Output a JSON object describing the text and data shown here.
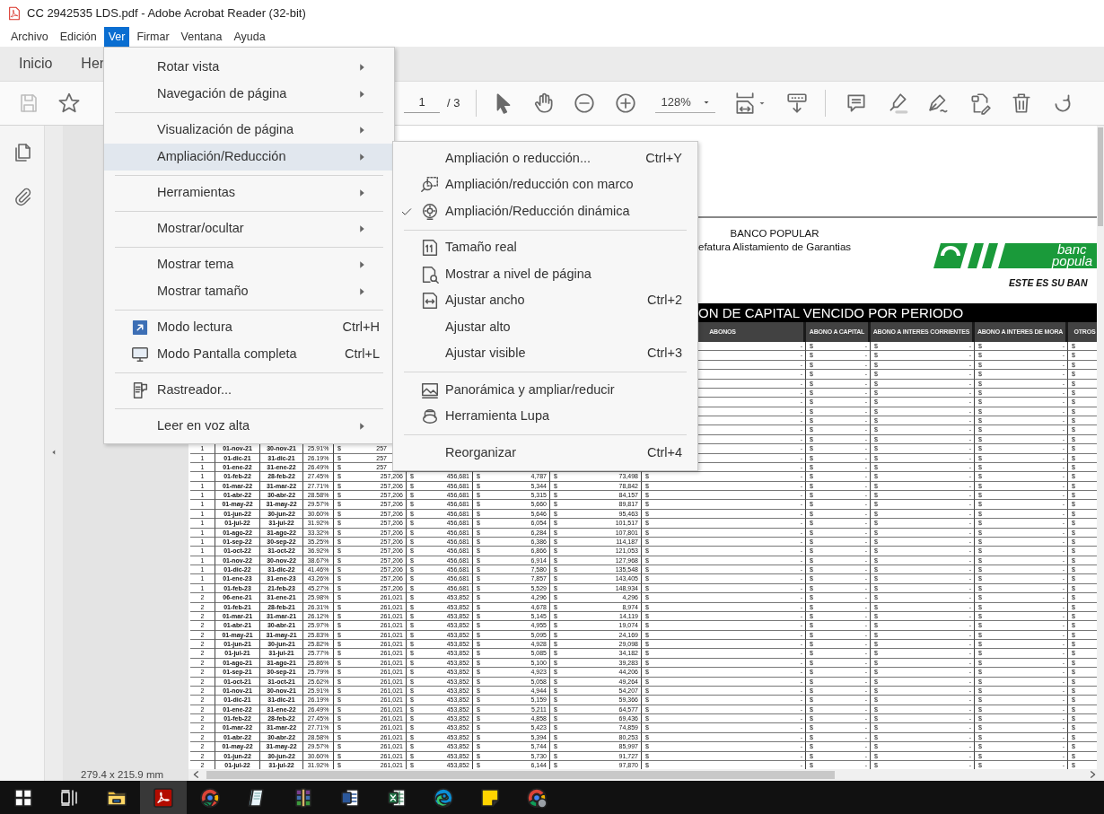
{
  "window": {
    "title": "CC 2942535 LDS.pdf - Adobe Acrobat Reader (32-bit)"
  },
  "menubar": [
    {
      "label": "Archivo",
      "selected": false
    },
    {
      "label": "Edición",
      "selected": false
    },
    {
      "label": "Ver",
      "selected": true
    },
    {
      "label": "Firmar",
      "selected": false
    },
    {
      "label": "Ventana",
      "selected": false
    },
    {
      "label": "Ayuda",
      "selected": false
    }
  ],
  "tabs": [
    {
      "label": "Inicio"
    },
    {
      "label": "Her"
    }
  ],
  "toolbar": {
    "save_disabled": true,
    "page": "1",
    "page_total": "/ 3",
    "zoom": "128%"
  },
  "view_menu": {
    "groups": [
      {
        "items": [
          {
            "label": "Rotar vista",
            "has_submenu": true,
            "selected": false
          },
          {
            "label": "Navegación de página",
            "has_submenu": true,
            "selected": false
          }
        ]
      },
      {
        "items": [
          {
            "label": "Visualización de página",
            "has_submenu": true,
            "selected": false
          },
          {
            "label": "Ampliación/Reducción",
            "has_submenu": true,
            "selected": true
          }
        ]
      },
      {
        "items": [
          {
            "label": "Herramientas",
            "has_submenu": true,
            "selected": false
          }
        ]
      },
      {
        "items": [
          {
            "label": "Mostrar/ocultar",
            "has_submenu": true,
            "selected": false
          }
        ]
      },
      {
        "items": [
          {
            "label": "Mostrar tema",
            "has_submenu": true,
            "selected": false
          },
          {
            "label": "Mostrar tamaño",
            "has_submenu": true,
            "selected": false
          }
        ]
      },
      {
        "items": [
          {
            "label": "Modo lectura",
            "shortcut": "Ctrl+H",
            "has_submenu": false,
            "selected": false
          },
          {
            "label": "Modo Pantalla completa",
            "shortcut": "Ctrl+L",
            "has_submenu": false,
            "selected": false
          }
        ]
      },
      {
        "items": [
          {
            "label": "Rastreador...",
            "has_submenu": false,
            "selected": false
          }
        ]
      },
      {
        "items": [
          {
            "label": "Leer en voz alta",
            "has_submenu": true,
            "selected": false
          }
        ]
      }
    ]
  },
  "zoom_submenu": {
    "groups": [
      {
        "items": [
          {
            "label": "Ampliación o reducción...",
            "shortcut": "Ctrl+Y",
            "checked": false
          },
          {
            "label": "Ampliación/reducción con marco",
            "checked": false
          },
          {
            "label": "Ampliación/Reducción dinámica",
            "checked": true
          }
        ]
      },
      {
        "items": [
          {
            "label": "Tamaño real",
            "checked": false
          },
          {
            "label": "Mostrar a nivel de página",
            "checked": false
          },
          {
            "label": "Ajustar ancho",
            "shortcut": "Ctrl+2",
            "checked": false
          },
          {
            "label": "Ajustar alto",
            "checked": false
          },
          {
            "label": "Ajustar visible",
            "shortcut": "Ctrl+3",
            "checked": false
          }
        ]
      },
      {
        "items": [
          {
            "label": "Panorámica y ampliar/reducir",
            "checked": false
          },
          {
            "label": "Herramienta Lupa",
            "checked": false
          }
        ]
      },
      {
        "items": [
          {
            "label": "Reorganizar",
            "shortcut": "Ctrl+4",
            "checked": false
          }
        ]
      }
    ]
  },
  "document": {
    "bank_name": "BANCO POPULAR",
    "department": "efatura Alistamiento de Garantias",
    "logo": {
      "line_1": "banc",
      "line_2": "popula",
      "slogan": "ESTE ES SU BAN"
    },
    "report_title": "ON DE CAPITAL VENCIDO POR PERIODO",
    "columns": [
      null,
      null,
      null,
      null,
      null,
      null,
      null,
      null,
      "ABONOS",
      "ABONO A CAPITAL",
      "ABONO A INTERES CORRIENTES",
      "ABONO A INTERES DE MORA",
      "OTROS"
    ],
    "rows": [
      {
        "kind": "right_only",
        "cells": [
          null,
          null,
          null,
          null,
          null,
          null,
          null,
          null,
          [
            null,
            "-"
          ],
          [
            "$",
            "-"
          ],
          [
            "$",
            "-"
          ],
          [
            "$",
            "-"
          ],
          [
            "$"
          ]
        ]
      },
      {
        "kind": "right_only",
        "cells": [
          null,
          null,
          null,
          null,
          null,
          null,
          null,
          null,
          [
            null,
            "-"
          ],
          [
            "$",
            "-"
          ],
          [
            "$",
            "-"
          ],
          [
            "$",
            "-"
          ],
          [
            "$"
          ]
        ]
      },
      {
        "kind": "right_only",
        "cells": [
          null,
          null,
          null,
          null,
          null,
          null,
          null,
          null,
          [
            null,
            "-"
          ],
          [
            "$",
            "-"
          ],
          [
            "$",
            "-"
          ],
          [
            "$",
            "-"
          ],
          [
            "$"
          ]
        ]
      },
      {
        "kind": "right_only",
        "cells": [
          null,
          null,
          null,
          null,
          null,
          null,
          null,
          null,
          [
            null,
            "-"
          ],
          [
            "$",
            "-"
          ],
          [
            "$",
            "-"
          ],
          [
            "$",
            "-"
          ],
          [
            "$"
          ]
        ]
      },
      {
        "kind": "right_only",
        "cells": [
          null,
          null,
          null,
          null,
          null,
          null,
          null,
          null,
          [
            null,
            "-"
          ],
          [
            "$",
            "-"
          ],
          [
            "$",
            "-"
          ],
          [
            "$",
            "-"
          ],
          [
            "$"
          ]
        ]
      },
      {
        "kind": "right_only",
        "cells": [
          null,
          null,
          null,
          null,
          null,
          null,
          null,
          null,
          [
            null,
            "-"
          ],
          [
            "$",
            "-"
          ],
          [
            "$",
            "-"
          ],
          [
            "$",
            "-"
          ],
          [
            "$"
          ]
        ]
      },
      {
        "kind": "right_only",
        "cells": [
          null,
          null,
          null,
          null,
          null,
          null,
          null,
          null,
          [
            null,
            "-"
          ],
          [
            "$",
            "-"
          ],
          [
            "$",
            "-"
          ],
          [
            "$",
            "-"
          ],
          [
            "$"
          ]
        ]
      },
      {
        "kind": "right_only",
        "cells": [
          null,
          null,
          null,
          null,
          null,
          null,
          null,
          null,
          [
            null,
            "-"
          ],
          [
            "$",
            "-"
          ],
          [
            "$",
            "-"
          ],
          [
            "$",
            "-"
          ],
          [
            "$"
          ]
        ]
      },
      {
        "kind": "right_only",
        "cells": [
          null,
          null,
          null,
          null,
          null,
          null,
          null,
          null,
          [
            null,
            "-"
          ],
          [
            "$",
            "-"
          ],
          [
            "$",
            "-"
          ],
          [
            "$",
            "-"
          ],
          [
            "$"
          ]
        ]
      },
      {
        "kind": "right_only",
        "cells": [
          null,
          null,
          null,
          null,
          null,
          null,
          null,
          null,
          [
            null,
            "-"
          ],
          [
            "$",
            "-"
          ],
          [
            "$",
            "-"
          ],
          [
            "$",
            "-"
          ],
          [
            "$"
          ]
        ]
      },
      {
        "kind": "right_only",
        "cells": [
          null,
          null,
          null,
          null,
          null,
          null,
          null,
          null,
          [
            null,
            "-"
          ],
          [
            "$",
            "-"
          ],
          [
            "$",
            "-"
          ],
          [
            "$",
            "-"
          ],
          [
            "$"
          ]
        ]
      },
      {
        "kind": "partial",
        "cells": [
          "1",
          "01-nov-21",
          "30-nov-21",
          "25.91%",
          [
            "$",
            "257"
          ],
          null,
          null,
          null,
          [
            null,
            "-"
          ],
          [
            "$",
            "-"
          ],
          [
            "$",
            "-"
          ],
          [
            "$",
            "-"
          ],
          [
            "$"
          ]
        ]
      },
      {
        "kind": "partial",
        "cells": [
          "1",
          "01-dic-21",
          "31-dic-21",
          "26.19%",
          [
            "$",
            "257"
          ],
          null,
          null,
          null,
          [
            null,
            "-"
          ],
          [
            "$",
            "-"
          ],
          [
            "$",
            "-"
          ],
          [
            "$",
            "-"
          ],
          [
            "$"
          ]
        ]
      },
      {
        "kind": "partial",
        "cells": [
          "1",
          "01-ene-22",
          "31-ene-22",
          "26.49%",
          [
            "$",
            "257"
          ],
          null,
          null,
          null,
          [
            null,
            "-"
          ],
          [
            "$",
            "-"
          ],
          [
            "$",
            "-"
          ],
          [
            "$",
            "-"
          ],
          [
            "$"
          ]
        ]
      },
      {
        "kind": "full",
        "cells": [
          "1",
          "01-feb-22",
          "28-feb-22",
          "27.45%",
          [
            "$",
            "257,206"
          ],
          [
            "$",
            "456,681"
          ],
          [
            "$",
            "4,787"
          ],
          [
            "$",
            "73,498"
          ],
          [
            "$",
            "-"
          ],
          [
            "$",
            "-"
          ],
          [
            "$",
            "-"
          ],
          [
            "$",
            "-"
          ],
          [
            "$"
          ]
        ]
      },
      {
        "kind": "full",
        "cells": [
          "1",
          "01-mar-22",
          "31-mar-22",
          "27.71%",
          [
            "$",
            "257,206"
          ],
          [
            "$",
            "456,681"
          ],
          [
            "$",
            "5,344"
          ],
          [
            "$",
            "78,842"
          ],
          [
            "$",
            "-"
          ],
          [
            "$",
            "-"
          ],
          [
            "$",
            "-"
          ],
          [
            "$",
            "-"
          ],
          [
            "$"
          ]
        ]
      },
      {
        "kind": "full",
        "cells": [
          "1",
          "01-abr-22",
          "30-abr-22",
          "28.58%",
          [
            "$",
            "257,206"
          ],
          [
            "$",
            "456,681"
          ],
          [
            "$",
            "5,315"
          ],
          [
            "$",
            "84,157"
          ],
          [
            "$",
            "-"
          ],
          [
            "$",
            "-"
          ],
          [
            "$",
            "-"
          ],
          [
            "$",
            "-"
          ],
          [
            "$"
          ]
        ]
      },
      {
        "kind": "full",
        "cells": [
          "1",
          "01-may-22",
          "31-may-22",
          "29.57%",
          [
            "$",
            "257,206"
          ],
          [
            "$",
            "456,681"
          ],
          [
            "$",
            "5,660"
          ],
          [
            "$",
            "89,817"
          ],
          [
            "$",
            "-"
          ],
          [
            "$",
            "-"
          ],
          [
            "$",
            "-"
          ],
          [
            "$",
            "-"
          ],
          [
            "$"
          ]
        ]
      },
      {
        "kind": "full",
        "cells": [
          "1",
          "01-jun-22",
          "30-jun-22",
          "30.60%",
          [
            "$",
            "257,206"
          ],
          [
            "$",
            "456,681"
          ],
          [
            "$",
            "5,646"
          ],
          [
            "$",
            "95,463"
          ],
          [
            "$",
            "-"
          ],
          [
            "$",
            "-"
          ],
          [
            "$",
            "-"
          ],
          [
            "$",
            "-"
          ],
          [
            "$"
          ]
        ]
      },
      {
        "kind": "full",
        "cells": [
          "1",
          "01-jul-22",
          "31-jul-22",
          "31.92%",
          [
            "$",
            "257,206"
          ],
          [
            "$",
            "456,681"
          ],
          [
            "$",
            "6,054"
          ],
          [
            "$",
            "101,517"
          ],
          [
            "$",
            "-"
          ],
          [
            "$",
            "-"
          ],
          [
            "$",
            "-"
          ],
          [
            "$",
            "-"
          ],
          [
            "$"
          ]
        ]
      },
      {
        "kind": "full",
        "cells": [
          "1",
          "01-ago-22",
          "31-ago-22",
          "33.32%",
          [
            "$",
            "257,206"
          ],
          [
            "$",
            "456,681"
          ],
          [
            "$",
            "6,284"
          ],
          [
            "$",
            "107,801"
          ],
          [
            "$",
            "-"
          ],
          [
            "$",
            "-"
          ],
          [
            "$",
            "-"
          ],
          [
            "$",
            "-"
          ],
          [
            "$"
          ]
        ]
      },
      {
        "kind": "full",
        "cells": [
          "1",
          "01-sep-22",
          "30-sep-22",
          "35.25%",
          [
            "$",
            "257,206"
          ],
          [
            "$",
            "456,681"
          ],
          [
            "$",
            "6,386"
          ],
          [
            "$",
            "114,187"
          ],
          [
            "$",
            "-"
          ],
          [
            "$",
            "-"
          ],
          [
            "$",
            "-"
          ],
          [
            "$",
            "-"
          ],
          [
            "$"
          ]
        ]
      },
      {
        "kind": "full",
        "cells": [
          "1",
          "01-oct-22",
          "31-oct-22",
          "36.92%",
          [
            "$",
            "257,206"
          ],
          [
            "$",
            "456,681"
          ],
          [
            "$",
            "6,866"
          ],
          [
            "$",
            "121,053"
          ],
          [
            "$",
            "-"
          ],
          [
            "$",
            "-"
          ],
          [
            "$",
            "-"
          ],
          [
            "$",
            "-"
          ],
          [
            "$"
          ]
        ]
      },
      {
        "kind": "full",
        "cells": [
          "1",
          "01-nov-22",
          "30-nov-22",
          "38.67%",
          [
            "$",
            "257,206"
          ],
          [
            "$",
            "456,681"
          ],
          [
            "$",
            "6,914"
          ],
          [
            "$",
            "127,968"
          ],
          [
            "$",
            "-"
          ],
          [
            "$",
            "-"
          ],
          [
            "$",
            "-"
          ],
          [
            "$",
            "-"
          ],
          [
            "$"
          ]
        ]
      },
      {
        "kind": "full",
        "cells": [
          "1",
          "01-dic-22",
          "31-dic-22",
          "41.46%",
          [
            "$",
            "257,206"
          ],
          [
            "$",
            "456,681"
          ],
          [
            "$",
            "7,580"
          ],
          [
            "$",
            "135,548"
          ],
          [
            "$",
            "-"
          ],
          [
            "$",
            "-"
          ],
          [
            "$",
            "-"
          ],
          [
            "$",
            "-"
          ],
          [
            "$"
          ]
        ]
      },
      {
        "kind": "full",
        "cells": [
          "1",
          "01-ene-23",
          "31-ene-23",
          "43.26%",
          [
            "$",
            "257,206"
          ],
          [
            "$",
            "456,681"
          ],
          [
            "$",
            "7,857"
          ],
          [
            "$",
            "143,405"
          ],
          [
            "$",
            "-"
          ],
          [
            "$",
            "-"
          ],
          [
            "$",
            "-"
          ],
          [
            "$",
            "-"
          ],
          [
            "$"
          ]
        ]
      },
      {
        "kind": "full",
        "cells": [
          "1",
          "01-feb-23",
          "21-feb-23",
          "45.27%",
          [
            "$",
            "257,206"
          ],
          [
            "$",
            "456,681"
          ],
          [
            "$",
            "5,529"
          ],
          [
            "$",
            "148,934"
          ],
          [
            "$",
            "-"
          ],
          [
            "$",
            "-"
          ],
          [
            "$",
            "-"
          ],
          [
            "$",
            "-"
          ],
          [
            "$"
          ]
        ]
      },
      {
        "kind": "full",
        "cells": [
          "2",
          "06-ene-21",
          "31-ene-21",
          "25.98%",
          [
            "$",
            "261,021"
          ],
          [
            "$",
            "453,852"
          ],
          [
            "$",
            "4,296"
          ],
          [
            "$",
            "4,296"
          ],
          [
            "$",
            "-"
          ],
          [
            "$",
            "-"
          ],
          [
            "$",
            "-"
          ],
          [
            "$",
            "-"
          ],
          [
            "$"
          ]
        ]
      },
      {
        "kind": "full",
        "cells": [
          "2",
          "01-feb-21",
          "28-feb-21",
          "26.31%",
          [
            "$",
            "261,021"
          ],
          [
            "$",
            "453,852"
          ],
          [
            "$",
            "4,678"
          ],
          [
            "$",
            "8,974"
          ],
          [
            "$",
            "-"
          ],
          [
            "$",
            "-"
          ],
          [
            "$",
            "-"
          ],
          [
            "$",
            "-"
          ],
          [
            "$"
          ]
        ]
      },
      {
        "kind": "full",
        "cells": [
          "2",
          "01-mar-21",
          "31-mar-21",
          "26.12%",
          [
            "$",
            "261,021"
          ],
          [
            "$",
            "453,852"
          ],
          [
            "$",
            "5,145"
          ],
          [
            "$",
            "14,119"
          ],
          [
            "$",
            "-"
          ],
          [
            "$",
            "-"
          ],
          [
            "$",
            "-"
          ],
          [
            "$",
            "-"
          ],
          [
            "$"
          ]
        ]
      },
      {
        "kind": "full",
        "cells": [
          "2",
          "01-abr-21",
          "30-abr-21",
          "25.97%",
          [
            "$",
            "261,021"
          ],
          [
            "$",
            "453,852"
          ],
          [
            "$",
            "4,955"
          ],
          [
            "$",
            "19,074"
          ],
          [
            "$",
            "-"
          ],
          [
            "$",
            "-"
          ],
          [
            "$",
            "-"
          ],
          [
            "$",
            "-"
          ],
          [
            "$"
          ]
        ]
      },
      {
        "kind": "full",
        "cells": [
          "2",
          "01-may-21",
          "31-may-21",
          "25.83%",
          [
            "$",
            "261,021"
          ],
          [
            "$",
            "453,852"
          ],
          [
            "$",
            "5,095"
          ],
          [
            "$",
            "24,169"
          ],
          [
            "$",
            "-"
          ],
          [
            "$",
            "-"
          ],
          [
            "$",
            "-"
          ],
          [
            "$",
            "-"
          ],
          [
            "$"
          ]
        ]
      },
      {
        "kind": "full",
        "cells": [
          "2",
          "01-jun-21",
          "30-jun-21",
          "25.82%",
          [
            "$",
            "261,021"
          ],
          [
            "$",
            "453,852"
          ],
          [
            "$",
            "4,928"
          ],
          [
            "$",
            "29,098"
          ],
          [
            "$",
            "-"
          ],
          [
            "$",
            "-"
          ],
          [
            "$",
            "-"
          ],
          [
            "$",
            "-"
          ],
          [
            "$"
          ]
        ]
      },
      {
        "kind": "full",
        "cells": [
          "2",
          "01-jul-21",
          "31-jul-21",
          "25.77%",
          [
            "$",
            "261,021"
          ],
          [
            "$",
            "453,852"
          ],
          [
            "$",
            "5,085"
          ],
          [
            "$",
            "34,182"
          ],
          [
            "$",
            "-"
          ],
          [
            "$",
            "-"
          ],
          [
            "$",
            "-"
          ],
          [
            "$",
            "-"
          ],
          [
            "$"
          ]
        ]
      },
      {
        "kind": "full",
        "cells": [
          "2",
          "01-ago-21",
          "31-ago-21",
          "25.86%",
          [
            "$",
            "261,021"
          ],
          [
            "$",
            "453,852"
          ],
          [
            "$",
            "5,100"
          ],
          [
            "$",
            "39,283"
          ],
          [
            "$",
            "-"
          ],
          [
            "$",
            "-"
          ],
          [
            "$",
            "-"
          ],
          [
            "$",
            "-"
          ],
          [
            "$"
          ]
        ]
      },
      {
        "kind": "full",
        "cells": [
          "2",
          "01-sep-21",
          "30-sep-21",
          "25.79%",
          [
            "$",
            "261,021"
          ],
          [
            "$",
            "453,852"
          ],
          [
            "$",
            "4,923"
          ],
          [
            "$",
            "44,206"
          ],
          [
            "$",
            "-"
          ],
          [
            "$",
            "-"
          ],
          [
            "$",
            "-"
          ],
          [
            "$",
            "-"
          ],
          [
            "$"
          ]
        ]
      },
      {
        "kind": "full",
        "cells": [
          "2",
          "01-oct-21",
          "31-oct-21",
          "25.62%",
          [
            "$",
            "261,021"
          ],
          [
            "$",
            "453,852"
          ],
          [
            "$",
            "5,058"
          ],
          [
            "$",
            "49,264"
          ],
          [
            "$",
            "-"
          ],
          [
            "$",
            "-"
          ],
          [
            "$",
            "-"
          ],
          [
            "$",
            "-"
          ],
          [
            "$"
          ]
        ]
      },
      {
        "kind": "full",
        "cells": [
          "2",
          "01-nov-21",
          "30-nov-21",
          "25.91%",
          [
            "$",
            "261,021"
          ],
          [
            "$",
            "453,852"
          ],
          [
            "$",
            "4,944"
          ],
          [
            "$",
            "54,207"
          ],
          [
            "$",
            "-"
          ],
          [
            "$",
            "-"
          ],
          [
            "$",
            "-"
          ],
          [
            "$",
            "-"
          ],
          [
            "$"
          ]
        ]
      },
      {
        "kind": "full",
        "cells": [
          "2",
          "01-dic-21",
          "31-dic-21",
          "26.19%",
          [
            "$",
            "261,021"
          ],
          [
            "$",
            "453,852"
          ],
          [
            "$",
            "5,159"
          ],
          [
            "$",
            "59,366"
          ],
          [
            "$",
            "-"
          ],
          [
            "$",
            "-"
          ],
          [
            "$",
            "-"
          ],
          [
            "$",
            "-"
          ],
          [
            "$"
          ]
        ]
      },
      {
        "kind": "full",
        "cells": [
          "2",
          "01-ene-22",
          "31-ene-22",
          "26.49%",
          [
            "$",
            "261,021"
          ],
          [
            "$",
            "453,852"
          ],
          [
            "$",
            "5,211"
          ],
          [
            "$",
            "64,577"
          ],
          [
            "$",
            "-"
          ],
          [
            "$",
            "-"
          ],
          [
            "$",
            "-"
          ],
          [
            "$",
            "-"
          ],
          [
            "$"
          ]
        ]
      },
      {
        "kind": "full",
        "cells": [
          "2",
          "01-feb-22",
          "28-feb-22",
          "27.45%",
          [
            "$",
            "261,021"
          ],
          [
            "$",
            "453,852"
          ],
          [
            "$",
            "4,858"
          ],
          [
            "$",
            "69,436"
          ],
          [
            "$",
            "-"
          ],
          [
            "$",
            "-"
          ],
          [
            "$",
            "-"
          ],
          [
            "$",
            "-"
          ],
          [
            "$"
          ]
        ]
      },
      {
        "kind": "full",
        "cells": [
          "2",
          "01-mar-22",
          "31-mar-22",
          "27.71%",
          [
            "$",
            "261,021"
          ],
          [
            "$",
            "453,852"
          ],
          [
            "$",
            "5,423"
          ],
          [
            "$",
            "74,859"
          ],
          [
            "$",
            "-"
          ],
          [
            "$",
            "-"
          ],
          [
            "$",
            "-"
          ],
          [
            "$",
            "-"
          ],
          [
            "$"
          ]
        ]
      },
      {
        "kind": "full",
        "cells": [
          "2",
          "01-abr-22",
          "30-abr-22",
          "28.58%",
          [
            "$",
            "261,021"
          ],
          [
            "$",
            "453,852"
          ],
          [
            "$",
            "5,394"
          ],
          [
            "$",
            "80,253"
          ],
          [
            "$",
            "-"
          ],
          [
            "$",
            "-"
          ],
          [
            "$",
            "-"
          ],
          [
            "$",
            "-"
          ],
          [
            "$"
          ]
        ]
      },
      {
        "kind": "full",
        "cells": [
          "2",
          "01-may-22",
          "31-may-22",
          "29.57%",
          [
            "$",
            "261,021"
          ],
          [
            "$",
            "453,852"
          ],
          [
            "$",
            "5,744"
          ],
          [
            "$",
            "85,997"
          ],
          [
            "$",
            "-"
          ],
          [
            "$",
            "-"
          ],
          [
            "$",
            "-"
          ],
          [
            "$",
            "-"
          ],
          [
            "$"
          ]
        ]
      },
      {
        "kind": "full",
        "cells": [
          "2",
          "01-jun-22",
          "30-jun-22",
          "30.60%",
          [
            "$",
            "261,021"
          ],
          [
            "$",
            "453,852"
          ],
          [
            "$",
            "5,730"
          ],
          [
            "$",
            "91,727"
          ],
          [
            "$",
            "-"
          ],
          [
            "$",
            "-"
          ],
          [
            "$",
            "-"
          ],
          [
            "$",
            "-"
          ],
          [
            "$"
          ]
        ]
      },
      {
        "kind": "full",
        "cells": [
          "2",
          "01-jul-22",
          "31-jul-22",
          "31.92%",
          [
            "$",
            "261,021"
          ],
          [
            "$",
            "453,852"
          ],
          [
            "$",
            "6,144"
          ],
          [
            "$",
            "97,870"
          ],
          [
            "$",
            "-"
          ],
          [
            "$",
            "-"
          ],
          [
            "$",
            "-"
          ],
          [
            "$",
            "-"
          ],
          [
            "$"
          ]
        ]
      }
    ]
  },
  "status_bar": {
    "page_size": "279.4 x 215.9 mm"
  },
  "taskbar": {
    "apps": [
      {
        "selected": false
      },
      {
        "selected": false
      },
      {
        "selected": false
      },
      {
        "selected": true
      },
      {
        "selected": false
      },
      {
        "selected": false
      },
      {
        "selected": false
      },
      {
        "selected": false
      },
      {
        "selected": false
      },
      {
        "selected": false
      },
      {
        "selected": false
      },
      {
        "selected": false
      }
    ]
  }
}
